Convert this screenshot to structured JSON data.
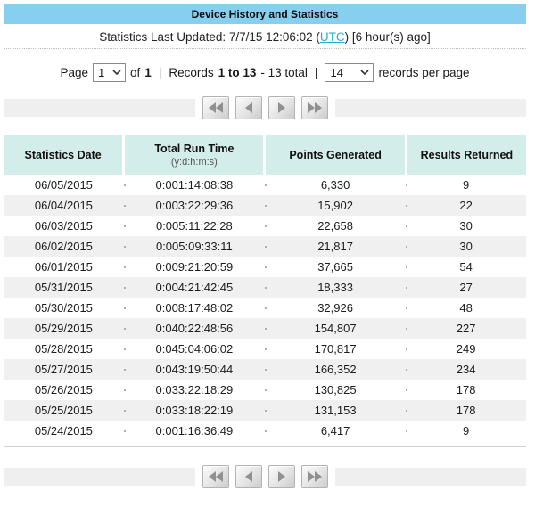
{
  "title": "Device History and Statistics",
  "updated": {
    "prefix": "Statistics Last Updated: 7/7/15 12:06:02 (",
    "link": "UTC",
    "suffix": ") [6 hour(s) ago]"
  },
  "pagination": {
    "page_label": "Page",
    "page_value": "1",
    "of_label": "of",
    "total_pages": "1",
    "separator": "|",
    "records_label": "Records",
    "records_range": "1 to 13",
    "records_total": "- 13 total",
    "per_page_value": "14",
    "per_page_label": "records per page"
  },
  "icons": {
    "page_select_chevron": "chevron-down",
    "per_page_select_chevron": "chevron-down",
    "first": "double-arrow-left",
    "previous": "arrow-left",
    "next": "arrow-right",
    "last": "double-arrow-right"
  },
  "table": {
    "columns": [
      {
        "label": "Statistics Date",
        "sublabel": ""
      },
      {
        "label": "Total Run Time",
        "sublabel": "(y:d:h:m:s)"
      },
      {
        "label": "Points Generated",
        "sublabel": ""
      },
      {
        "label": "Results Returned",
        "sublabel": ""
      }
    ],
    "rows": [
      [
        "06/05/2015",
        "0:001:14:08:38",
        "6,330",
        "9"
      ],
      [
        "06/04/2015",
        "0:003:22:29:36",
        "15,902",
        "22"
      ],
      [
        "06/03/2015",
        "0:005:11:22:28",
        "22,658",
        "30"
      ],
      [
        "06/02/2015",
        "0:005:09:33:11",
        "21,817",
        "30"
      ],
      [
        "06/01/2015",
        "0:009:21:20:59",
        "37,665",
        "54"
      ],
      [
        "05/31/2015",
        "0:004:21:42:45",
        "18,333",
        "27"
      ],
      [
        "05/30/2015",
        "0:008:17:48:02",
        "32,926",
        "48"
      ],
      [
        "05/29/2015",
        "0:040:22:48:56",
        "154,807",
        "227"
      ],
      [
        "05/28/2015",
        "0:045:04:06:02",
        "170,817",
        "249"
      ],
      [
        "05/27/2015",
        "0:043:19:50:44",
        "166,352",
        "234"
      ],
      [
        "05/26/2015",
        "0:033:22:18:29",
        "130,825",
        "178"
      ],
      [
        "05/25/2015",
        "0:033:18:22:19",
        "131,153",
        "178"
      ],
      [
        "05/24/2015",
        "0:001:16:36:49",
        "6,417",
        "9"
      ]
    ]
  },
  "colors": {
    "title_bar_bg": "#87CFEF",
    "table_header_bg": "#D3EDEB",
    "row_stripe": "#F0F0F0",
    "link": "#2BA9CE",
    "nav_bar_bg": "#EFEFEF"
  }
}
